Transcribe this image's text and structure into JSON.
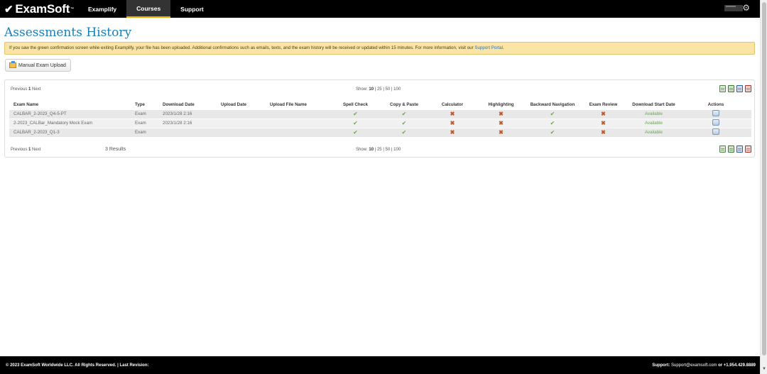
{
  "nav": {
    "logo": "ExamSoft",
    "links": [
      "Examplify",
      "Courses",
      "Support"
    ],
    "active": "Courses"
  },
  "page_title": "Assessments History",
  "notice": {
    "text": "If you saw the green confirmation screen while exiting Examplify, your file has been uploaded. Additional confirmations such as emails, texts, and the exam history will be received or updated within 15 minutes. For more information, visit our ",
    "link": "Support Portal",
    "end": "."
  },
  "upload_button": "Manual Exam Upload",
  "pager": {
    "previous": "Previous",
    "page": "1",
    "next": "Next"
  },
  "show": {
    "label": "Show:",
    "options": [
      "10",
      "25",
      "50",
      "100"
    ],
    "selected": "10",
    "sep": "|"
  },
  "results_text": "3 Results",
  "exports": [
    "csv-icon",
    "excel-icon",
    "word-icon",
    "pdf-icon"
  ],
  "table": {
    "headers": [
      "Exam Name",
      "Type",
      "Download Date",
      "Upload Date",
      "Upload File Name",
      "Spell Check",
      "Copy & Paste",
      "Calculator",
      "Highlighting",
      "Backward Navigation",
      "Exam Review",
      "Download Start Date",
      "Actions"
    ],
    "rows": [
      {
        "name": "CALBAR_2-2023_Q4-5-PT",
        "type": "Exam",
        "download_date": "2023/1/28 2:16",
        "upload_date": "",
        "upload_file": "",
        "spell": "✔",
        "copy": "✔",
        "calc": "✖",
        "highlight": "✖",
        "backnav": "✔",
        "review": "✖",
        "start": "Available"
      },
      {
        "name": "2-2023_CALBar_Mandatory Mock Exam",
        "type": "Exam",
        "download_date": "2023/1/28 2:16",
        "upload_date": "",
        "upload_file": "",
        "spell": "✔",
        "copy": "✔",
        "calc": "✖",
        "highlight": "✖",
        "backnav": "✔",
        "review": "✖",
        "start": "Available"
      },
      {
        "name": "CALBAR_2-2023_Q1-3",
        "type": "Exam",
        "download_date": "",
        "upload_date": "",
        "upload_file": "",
        "spell": "✔",
        "copy": "✔",
        "calc": "✖",
        "highlight": "✖",
        "backnav": "✔",
        "review": "✖",
        "start": "Available"
      }
    ]
  },
  "footer": {
    "left": "© 2023 ExamSoft Worldwide LLC. All Rights Reserved. | Last Revision:",
    "support_label": "Support:",
    "support_email": "Support@examsoft.com",
    "support_or": "or",
    "support_phone": "+1.954.429.8889"
  },
  "colors": {
    "title": "#1a7fb8",
    "notice_bg": "#fbe5a6",
    "ok": "#6aa84f",
    "no": "#c0582e",
    "accent": "#f2a900"
  }
}
